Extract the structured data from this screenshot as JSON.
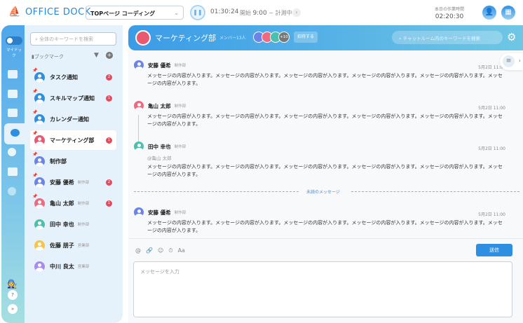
{
  "header": {
    "logo": "OFFICE DOCK",
    "project": "TOPページ コーディング",
    "timer": "01:30:24",
    "start_label": "開始",
    "start_time": "9:00",
    "tilde": "~",
    "status": "計測中",
    "worktime_label": "本日の作業時間",
    "worktime": "02:20:30"
  },
  "rail": {
    "toggle_label": "マイドック",
    "help": "?",
    "expand": "»"
  },
  "sidebar": {
    "search_placeholder": "全体のキーワードを検索",
    "bookmark_label": "ブックマーク",
    "items": [
      {
        "name": "タスク通知",
        "dept": "",
        "badge": "2",
        "color": "#2e8fe0"
      },
      {
        "name": "スキルマップ通知",
        "dept": "",
        "badge": "1",
        "color": "#2e8fe0"
      },
      {
        "name": "カレンダー通知",
        "dept": "",
        "badge": "",
        "color": "#2e8fe0"
      },
      {
        "name": "マーケティング部",
        "dept": "",
        "badge": "1",
        "color": "#e95a70"
      },
      {
        "name": "制作部",
        "dept": "",
        "badge": "",
        "color": "#6b84e8"
      },
      {
        "name": "安藤 優希",
        "dept": "制作部",
        "badge": "2",
        "color": "#6b84e8"
      },
      {
        "name": "亀山 太郎",
        "dept": "制作部",
        "badge": "1",
        "color": "#ef6a80"
      },
      {
        "name": "田中 幸也",
        "dept": "制作部",
        "badge": "",
        "color": "#4cc0ad"
      },
      {
        "name": "佐藤 朋子",
        "dept": "営業部",
        "badge": "",
        "color": "#f7c443"
      },
      {
        "name": "中川 良太",
        "dept": "営業部",
        "badge": "",
        "color": "#a88cef"
      }
    ]
  },
  "room": {
    "title": "マーケティング部",
    "members": "メンバー13人",
    "more": "+10",
    "invite": "招待する",
    "search_placeholder": "チャットルーム内のキーワードを検索"
  },
  "messages": [
    {
      "name": "安藤 優希",
      "dept": "制作部",
      "time": "5月2日 11:00",
      "mention": "",
      "text": "メッセージの内容が入ります。メッセージの内容が入ります。メッセージの内容が入ります。メッセージの内容が入ります。メッセージの内容が入ります。メッセージの内容が入ります。",
      "color": "#6b84e8"
    },
    {
      "name": "亀山 太郎",
      "dept": "制作部",
      "time": "5月2日 11:00",
      "mention": "",
      "text": "メッセージの内容が入ります。メッセージの内容が入ります。メッセージの内容が入ります。メッセージの内容が入ります。メッセージの内容が入ります。メッセージの内容が入ります。",
      "color": "#ef6a80"
    },
    {
      "name": "田中 幸也",
      "dept": "制作部",
      "time": "5月2日 11:00",
      "mention": "@亀山 太郎",
      "text": "メッセージの内容が入ります。メッセージの内容が入ります。メッセージの内容が入ります。メッセージの内容が入ります。メッセージの内容が入ります。メッセージの内容が入ります。",
      "color": "#4cc0ad"
    },
    {
      "name": "安藤 優希",
      "dept": "制作部",
      "time": "5月2日 11:00",
      "mention": "",
      "text": "メッセージの内容が入ります。メッセージの内容が入ります。メッセージの内容が入ります。メッセージの内容が入ります。メッセージの内容が入ります。メッセージの内容が入ります。",
      "color": "#6b84e8"
    }
  ],
  "unread_label": "未読のメッセージ",
  "composer": {
    "tools": [
      "@",
      "🔗",
      "☺",
      "⏱",
      "Aa"
    ],
    "send": "送信",
    "placeholder": "メッセージを入力"
  }
}
